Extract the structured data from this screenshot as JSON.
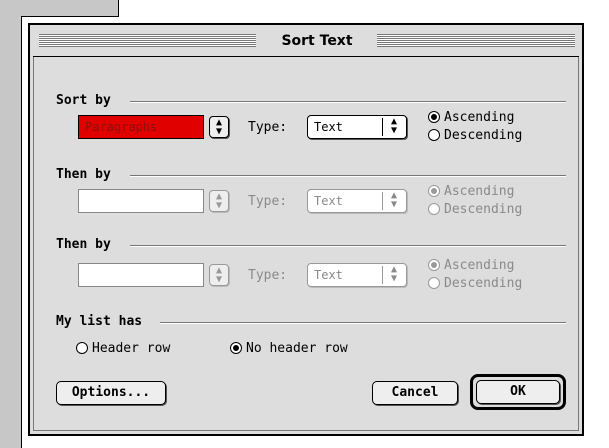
{
  "dialog": {
    "title": "Sort Text",
    "sort_by": {
      "label": "Sort by",
      "field_value": "Paragraphs",
      "type_label": "Type:",
      "type_value": "Text",
      "ascending_label": "Ascending",
      "descending_label": "Descending",
      "selected": "Ascending"
    },
    "then_by_1": {
      "label": "Then by",
      "field_value": "",
      "type_label": "Type:",
      "type_value": "Text",
      "ascending_label": "Ascending",
      "descending_label": "Descending",
      "selected": "Ascending",
      "enabled": false
    },
    "then_by_2": {
      "label": "Then by",
      "field_value": "",
      "type_label": "Type:",
      "type_value": "Text",
      "ascending_label": "Ascending",
      "descending_label": "Descending",
      "selected": "Ascending",
      "enabled": false
    },
    "my_list_has": {
      "label": "My list has",
      "header_row_label": "Header row",
      "no_header_row_label": "No header row",
      "selected": "No header row"
    },
    "buttons": {
      "options": "Options...",
      "cancel": "Cancel",
      "ok": "OK"
    }
  },
  "colors": {
    "dialog_bg": "#dddddd",
    "highlight_field": "#e00000",
    "disabled_text": "#8a8a8a"
  },
  "icons": {
    "popup_arrow": "updown-arrows-icon",
    "radio": "radio-icon"
  }
}
